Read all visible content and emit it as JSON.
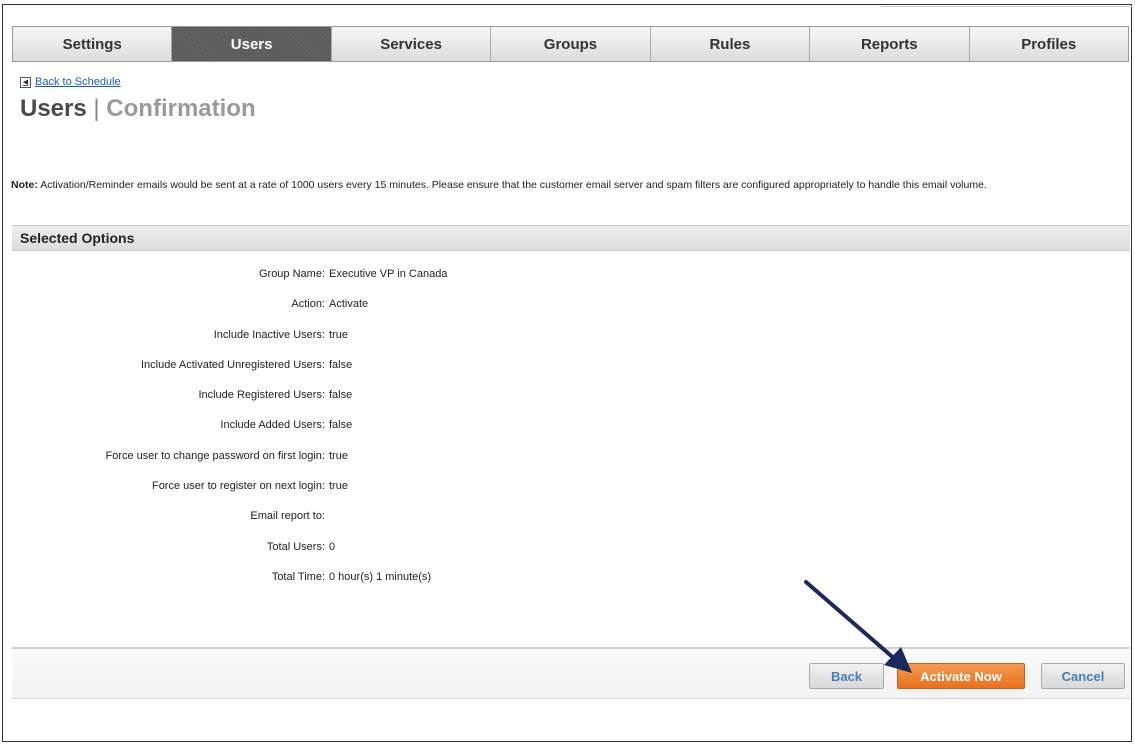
{
  "tabs": [
    {
      "label": "Settings",
      "active": false
    },
    {
      "label": "Users",
      "active": true
    },
    {
      "label": "Services",
      "active": false
    },
    {
      "label": "Groups",
      "active": false
    },
    {
      "label": "Rules",
      "active": false
    },
    {
      "label": "Reports",
      "active": false
    },
    {
      "label": "Profiles",
      "active": false
    }
  ],
  "nav": {
    "back_link": "Back to Schedule"
  },
  "title": {
    "main": "Users",
    "separator": "|",
    "sub": "Confirmation"
  },
  "note": {
    "label": "Note:",
    "text": "Activation/Reminder emails would be sent at a rate of 1000 users every 15 minutes. Please ensure that the customer email server and spam filters are configured appropriately to handle this email volume."
  },
  "section": {
    "title": "Selected Options"
  },
  "options": [
    {
      "label": "Group Name:",
      "value": "Executive VP in Canada"
    },
    {
      "label": "Action:",
      "value": "Activate"
    },
    {
      "label": "Include Inactive Users:",
      "value": "true"
    },
    {
      "label": "Include Activated Unregistered Users:",
      "value": "false"
    },
    {
      "label": "Include Registered Users:",
      "value": "false"
    },
    {
      "label": "Include Added Users:",
      "value": "false"
    },
    {
      "label": "Force user to change password on first login:",
      "value": "true"
    },
    {
      "label": "Force user to register on next login:",
      "value": "true"
    },
    {
      "label": "Email report to:",
      "value": ""
    },
    {
      "label": "Total Users:",
      "value": "0"
    },
    {
      "label": "Total Time:",
      "value": "0 hour(s) 1 minute(s)"
    }
  ],
  "buttons": {
    "back": "Back",
    "activate": "Activate Now",
    "cancel": "Cancel"
  },
  "colors": {
    "accent": "#e8711e",
    "active_tab": "#5b5b5b",
    "link": "#1a5fb4",
    "annotation_arrow": "#1b2a5c"
  }
}
